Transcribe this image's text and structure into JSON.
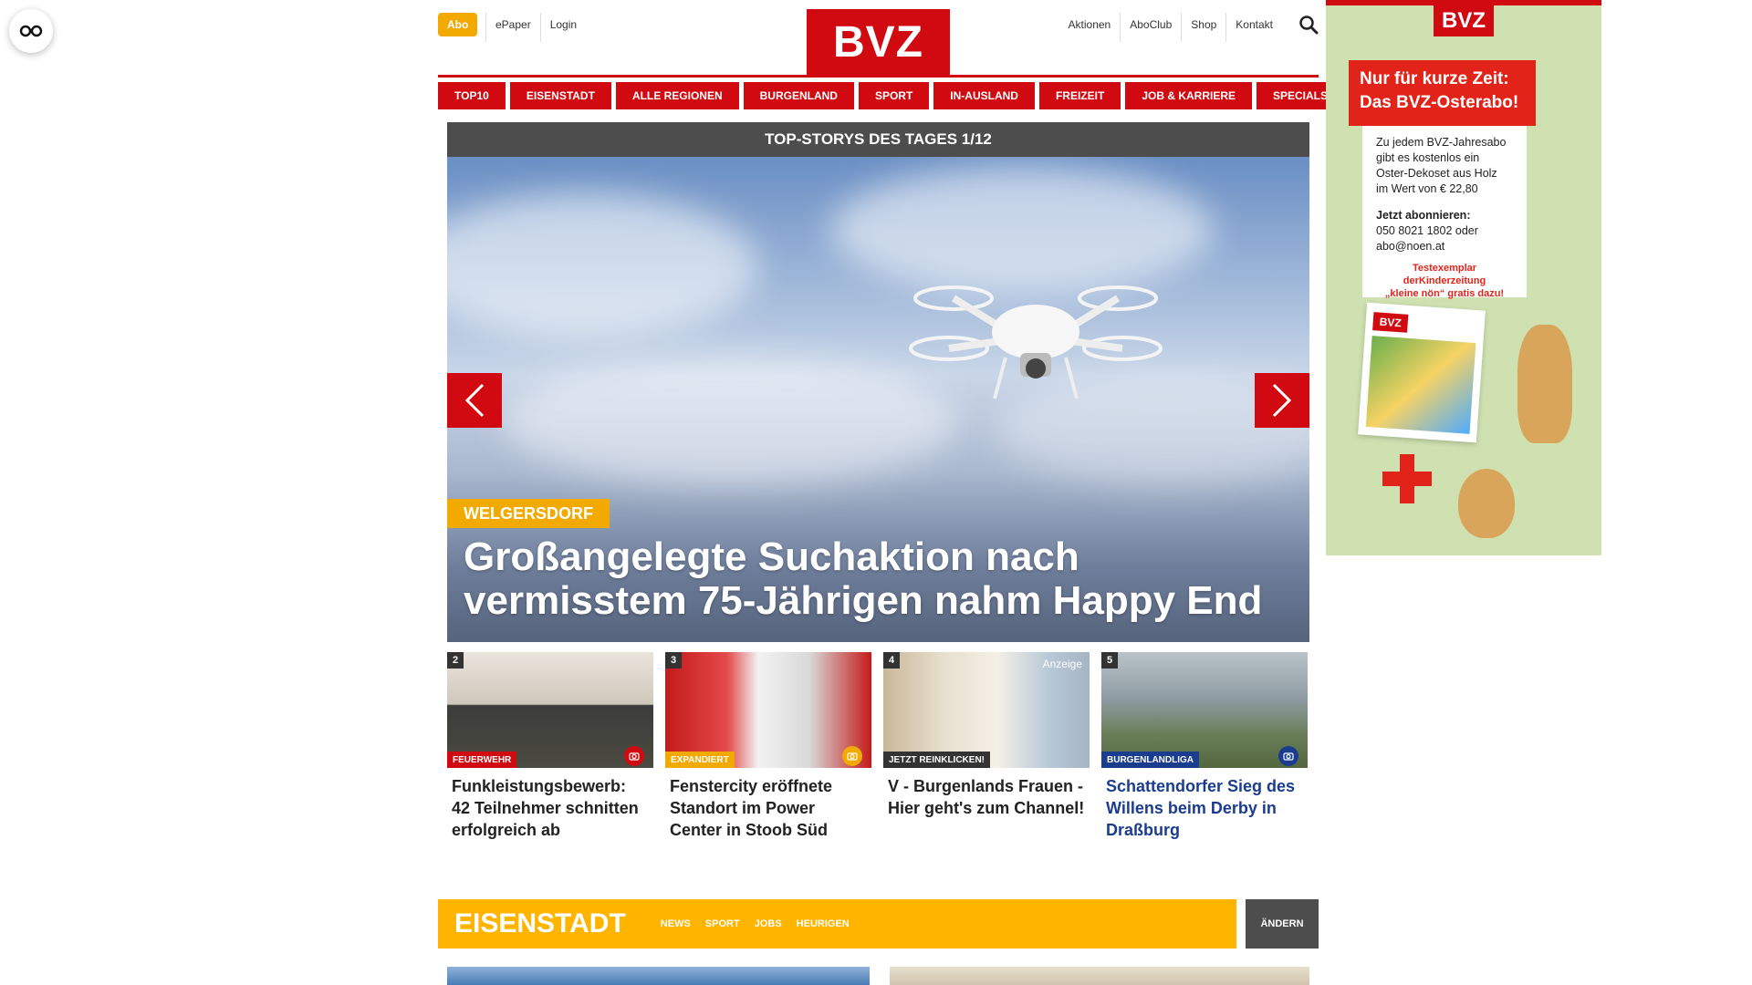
{
  "top": {
    "abo": "Abo",
    "left_links": [
      "ePaper",
      "Login"
    ],
    "logo": "BVZ",
    "right_links": [
      "Aktionen",
      "AboClub",
      "Shop",
      "Kontakt"
    ]
  },
  "nav": [
    "TOP10",
    "EISENSTADT",
    "ALLE REGIONEN",
    "BURGENLAND",
    "SPORT",
    "IN-AUSLAND",
    "FREIZEIT",
    "JOB & KARRIERE",
    "SPECIALS"
  ],
  "hero": {
    "header": "TOP-STORYS DES TAGES 1/12",
    "tag": "WELGERSDORF",
    "title": "Großangelegte Suchaktion nach vermisstem 75-Jährigen nahm Happy End"
  },
  "cards": [
    {
      "num": "2",
      "cat": "FEUERWEHR",
      "cat_color": "#d10a11",
      "title": "Funkleistungsbewerb: 42 Teilnehmer schnitten erfolgreich ab",
      "camera": true,
      "ad": ""
    },
    {
      "num": "3",
      "cat": "EXPANDIERT",
      "cat_color": "#f2a900",
      "title": "Fenstercity eröffnete Standort im Power Center in Stoob Süd",
      "camera": true,
      "ad": ""
    },
    {
      "num": "4",
      "cat": "JETZT REINKLICKEN!",
      "cat_color": "#333333",
      "title": "V - Burgenlands Frauen - Hier geht's zum Channel!",
      "camera": false,
      "ad": "Anzeige"
    },
    {
      "num": "5",
      "cat": "BURGENLANDLIGA",
      "cat_color": "#1a3d8f",
      "title": "Schattendorfer Sieg des Willens beim Derby in Draßburg",
      "camera": true,
      "ad": ""
    }
  ],
  "section": {
    "title": "EISENSTADT",
    "links": [
      "NEWS",
      "SPORT",
      "JOBS",
      "HEURIGEN"
    ],
    "change": "ÄNDERN"
  },
  "ad": {
    "logo": "BVZ",
    "headline_1": "Nur für kurze Zeit:",
    "headline_2": "Das BVZ-Osterabo!",
    "body_1": "Zu jedem BVZ-Jahresabo",
    "body_2": "gibt es kostenlos ein",
    "body_3": "Oster-Dekoset aus Holz",
    "body_4": "im Wert von € 22,80",
    "cta": "Jetzt abonnieren:",
    "phone": "050 8021 1802 oder",
    "email": "abo@noen.at",
    "free_1": "Testexemplar derKinderzeitung",
    "free_2": "„kleine nön“ gratis dazu!",
    "mag_logo": "BVZ"
  },
  "colors": {
    "brand_red": "#d10a11",
    "accent_yellow": "#ffb400",
    "dark_bar": "#4d4d4d"
  }
}
